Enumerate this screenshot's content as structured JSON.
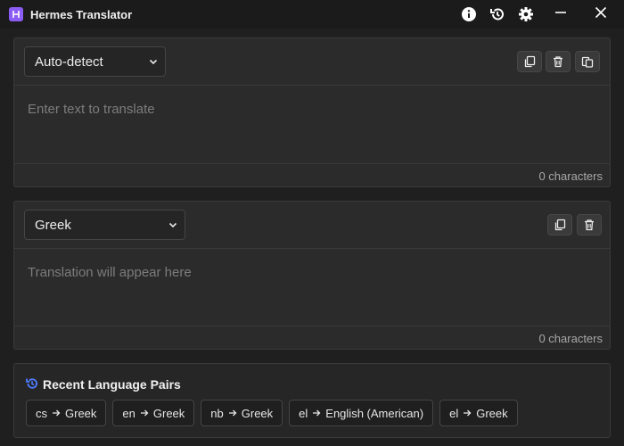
{
  "app": {
    "title": "Hermes Translator"
  },
  "source": {
    "language": "Auto-detect",
    "placeholder": "Enter text to translate",
    "char_count": "0 characters"
  },
  "target": {
    "language": "Greek",
    "placeholder": "Translation will appear here",
    "char_count": "0 characters"
  },
  "recent": {
    "title": "Recent Language Pairs",
    "pairs": [
      {
        "from": "cs",
        "to": "Greek"
      },
      {
        "from": "en",
        "to": "Greek"
      },
      {
        "from": "nb",
        "to": "Greek"
      },
      {
        "from": "el",
        "to": "English (American)"
      },
      {
        "from": "el",
        "to": "Greek"
      }
    ]
  },
  "icons": {
    "app_logo": "hermes-logo-icon",
    "info": "info-icon",
    "history": "history-icon",
    "settings": "gear-icon",
    "minimize": "minimize-icon",
    "close": "close-icon"
  },
  "colors": {
    "accent": "#8b5cf6",
    "history_accent": "#4f7dff"
  }
}
